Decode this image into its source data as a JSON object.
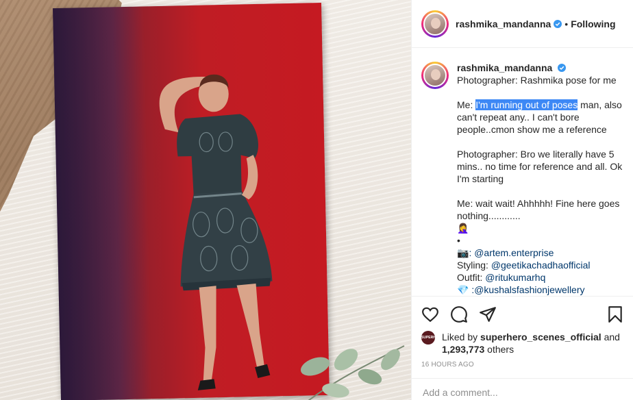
{
  "post": {
    "username": "rashmika_mandanna",
    "verified_icon": "verified-badge-icon",
    "separator": "•",
    "follow_status": "Following"
  },
  "caption": {
    "username": "rashmika_mandanna",
    "line1": "Photographer: Rashmika pose for me",
    "me_prefix": "Me: ",
    "me_highlight": "I'm running out of poses",
    "me_rest": " man, also can't repeat any.. I can't bore people..cmon show me a reference",
    "photographer2": "Photographer: Bro we literally have 5 mins.. no time for reference and all. Ok I'm starting",
    "me2": "Me: wait wait! Ahhhhh! Fine here goes nothing............",
    "emoji_woman": "🤦‍♀️",
    "bullet": "•",
    "camera_emoji": "📷",
    "camera_credit": ": @artem.enterprise",
    "styling_label": "Styling: ",
    "styling_tag": "@geetikachadhaofficial",
    "outfit_label": "Outfit: ",
    "outfit_tag": "@ritukumarhq",
    "gem_emoji": "💎",
    "jewellery_credit": " :@kushalsfashionjewellery"
  },
  "actions": {
    "icons": [
      "heart-icon",
      "comment-icon",
      "share-icon",
      "bookmark-icon"
    ]
  },
  "likes": {
    "avatar_text": "SUPERHERO",
    "liked_by": "Liked by ",
    "user": "superhero_scenes_official",
    "and": " and",
    "count": "1,293,773",
    "others": " others"
  },
  "timestamp": "16 HOURS AGO",
  "comment": {
    "placeholder": "Add a comment..."
  }
}
